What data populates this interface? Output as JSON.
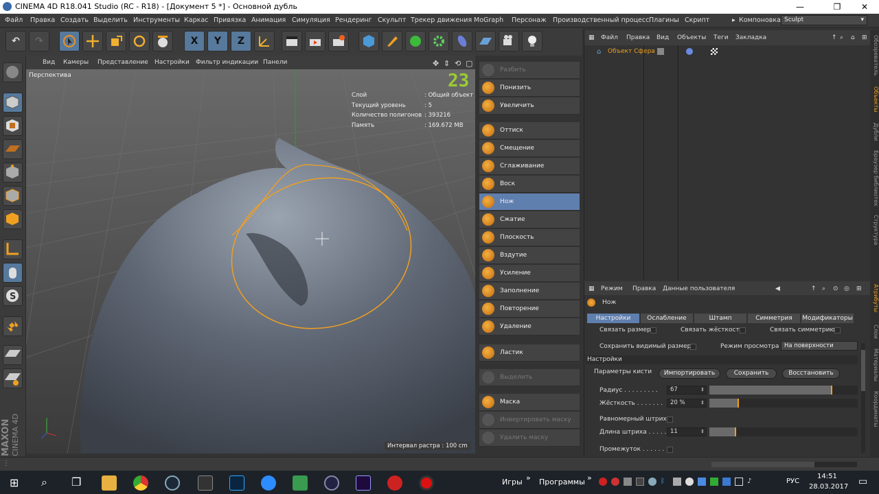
{
  "window": {
    "title": "CINEMA 4D R18.041 Studio (RC - R18) - [Документ 5 *] - Основной дубль",
    "min": "—",
    "max": "❐",
    "close": "✕"
  },
  "menubar": {
    "items": [
      "Файл",
      "Правка",
      "Создать",
      "Выделить",
      "Инструменты",
      "Каркас",
      "Привязка",
      "Анимация",
      "Симуляция",
      "Рендеринг",
      "Скульпт",
      "Трекер движения",
      "MoGraph",
      "Персонаж",
      "Производственный процесс",
      "Плагины",
      "Скрипт"
    ],
    "layout_label": "Компоновка",
    "layout_value": "Sculpt"
  },
  "toolbar": {
    "x": "X",
    "y": "Y",
    "z": "Z"
  },
  "viewport": {
    "menu": [
      "Вид",
      "Камеры",
      "Представление",
      "Настройки",
      "Фильтр индикации",
      "Панели"
    ],
    "view_name": "Перспектива",
    "fps": "23",
    "hud_keys": [
      "Слой",
      "Текущий уровень",
      "Количество полигонов",
      "Память"
    ],
    "hud_values": [
      ": Общий объект",
      ": 5",
      ": 393216",
      ": 169.672 MB"
    ],
    "grid_interval": "Интервал растра : 100 cm",
    "logo1": "MAXON",
    "logo2": "CINEMA 4D"
  },
  "brushes": {
    "items": [
      "Разбить",
      "Понизить",
      "Увеличить",
      "Оттиск",
      "Смещение",
      "Сглаживание",
      "Воск",
      "Нож",
      "Сжатие",
      "Плоскость",
      "Вздутие",
      "Усиление",
      "Заполнение",
      "Повторение",
      "Удаление",
      "Ластик",
      "Выделить",
      "Маска",
      "Инвертировать маску",
      "Удалить маску"
    ],
    "selected": "Нож"
  },
  "objects": {
    "menu": [
      "Файл",
      "Правка",
      "Вид",
      "Объекты",
      "Теги",
      "Закладка"
    ],
    "object_name": "Объект Сфера"
  },
  "attributes": {
    "menu": [
      "Режим",
      "Правка",
      "Данные пользователя"
    ],
    "tool_name": "Нож",
    "tabs": [
      "Настройки",
      "Ослабление",
      "Штамп",
      "Симметрия",
      "Модификаторы"
    ],
    "link_size": "Связать размер",
    "link_hardness": "Связать жёсткость",
    "link_symmetry": "Связать симметрию",
    "keep_visible_size": "Сохранить видимый размер",
    "view_mode_label": "Режим просмотра",
    "view_mode_value": "На поверхности",
    "section": "Настройки",
    "brush_params": "Параметры кисти",
    "import_btn": "Импортировать",
    "save_btn": "Сохранить",
    "restore_btn": "Восстановить",
    "radius_label": "Радиус . . . . . . . . .",
    "radius_value": "67",
    "radius_fraction": 0.83,
    "hardness_label": "Жёсткость . . . . . . .",
    "hardness_value": "20 %",
    "hardness_fraction": 0.2,
    "even_stroke": "Равномерный штрих",
    "stroke_length_label": "Длина штриха . . . . .",
    "stroke_length_value": "11",
    "stroke_fraction": 0.18,
    "spacing_label": "Промежуток . . . . . ."
  },
  "sidetabs": [
    "Обозреватель",
    "Объекты",
    "Дубли",
    "Браузер библиотек",
    "Структура",
    "Атрибуты",
    "Слои",
    "Материалы",
    "Координаты"
  ],
  "taskbar": {
    "games": "Игры",
    "programs": "Программы",
    "chev1": "»",
    "chev2": "»",
    "lang": "РУС",
    "time": "14:51",
    "date": "28.03.2017"
  },
  "colors": {
    "accent_orange": "#f0a020",
    "selection_blue": "#5f7fae",
    "hud_green": "#9acd32"
  }
}
